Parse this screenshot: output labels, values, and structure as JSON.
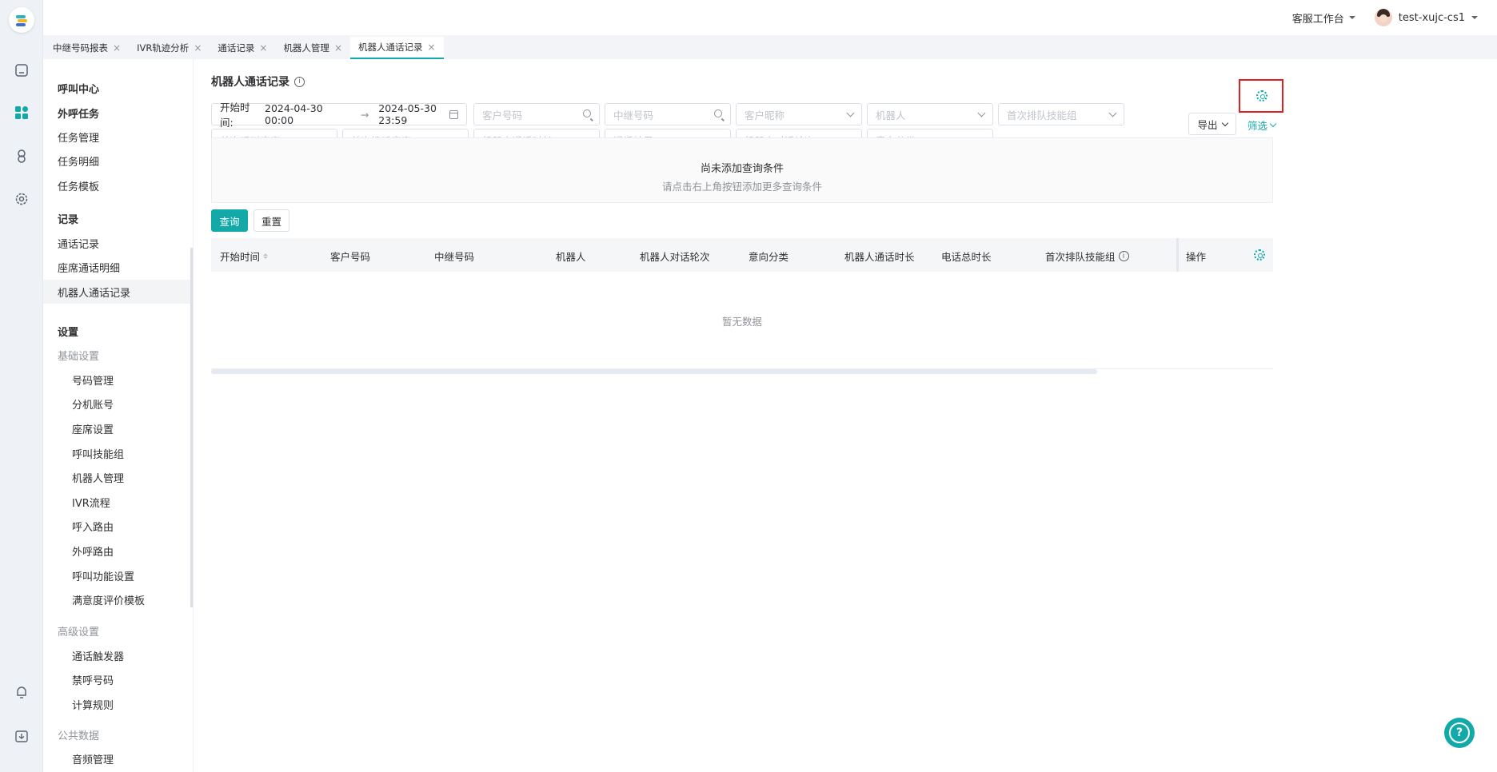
{
  "header": {
    "workbench": "客服工作台",
    "username": "test-xujc-cs1"
  },
  "tabs": [
    {
      "label": "中继号码报表",
      "close": "×"
    },
    {
      "label": "IVR轨迹分析",
      "close": "×"
    },
    {
      "label": "通话记录",
      "close": "×"
    },
    {
      "label": "机器人管理",
      "close": "×"
    },
    {
      "label": "机器人通话记录",
      "close": "×",
      "active": true
    }
  ],
  "sidebar": {
    "call_center": "呼叫中心",
    "outbound": "外呼任务",
    "task_manage": "任务管理",
    "task_detail": "任务明细",
    "task_template": "任务模板",
    "records": "记录",
    "call_records": "通话记录",
    "seat_detail": "座席通话明细",
    "robot_records": "机器人通话记录",
    "settings": "设置",
    "basic": "基础设置",
    "number_manage": "号码管理",
    "extension": "分机账号",
    "seat_settings": "座席设置",
    "skill_group": "呼叫技能组",
    "robot_manage": "机器人管理",
    "ivr_flow": "IVR流程",
    "inbound_route": "呼入路由",
    "outbound_route": "外呼路由",
    "call_function": "呼叫功能设置",
    "satisfaction": "满意度评价模板",
    "advanced": "高级设置",
    "trigger": "通话触发器",
    "blocked": "禁呼号码",
    "billing": "计算规则",
    "public_data": "公共数据",
    "audio": "音频管理"
  },
  "page": {
    "title": "机器人通话记录",
    "info": "i"
  },
  "filters": {
    "start_label": "开始时间:",
    "start_from": "2024-04-30 00:00",
    "arrow": "→",
    "start_to": "2024-05-30 23:59",
    "customer_number": "客户号码",
    "trunk_number": "中继号码",
    "customer_nick": "客户昵称",
    "robot": "机器人",
    "first_queue_skill": "首次排队技能组",
    "first_call_seat": "首次呼叫座席",
    "first_answer_seat": "首次接听座席",
    "robot_call_duration": "机器人通话时长",
    "call_result": "通话结果",
    "robot_turns": "机器人对话轮次",
    "intent": "意向分类",
    "export": "导出",
    "filter": "筛选"
  },
  "empty_conditions": {
    "title": "尚未添加查询条件",
    "hint": "请点击右上角按钮添加更多查询条件"
  },
  "actions": {
    "query": "查询",
    "reset": "重置"
  },
  "table": {
    "columns": [
      "开始时间",
      "客户号码",
      "中继号码",
      "机器人",
      "机器人对话轮次",
      "意向分类",
      "机器人通话时长",
      "电话总时长",
      "首次排队技能组",
      "操作"
    ],
    "empty": "暂无数据"
  },
  "colors": {
    "accent": "#14a9a9",
    "highlight_box": "#e02020"
  },
  "help": "?"
}
